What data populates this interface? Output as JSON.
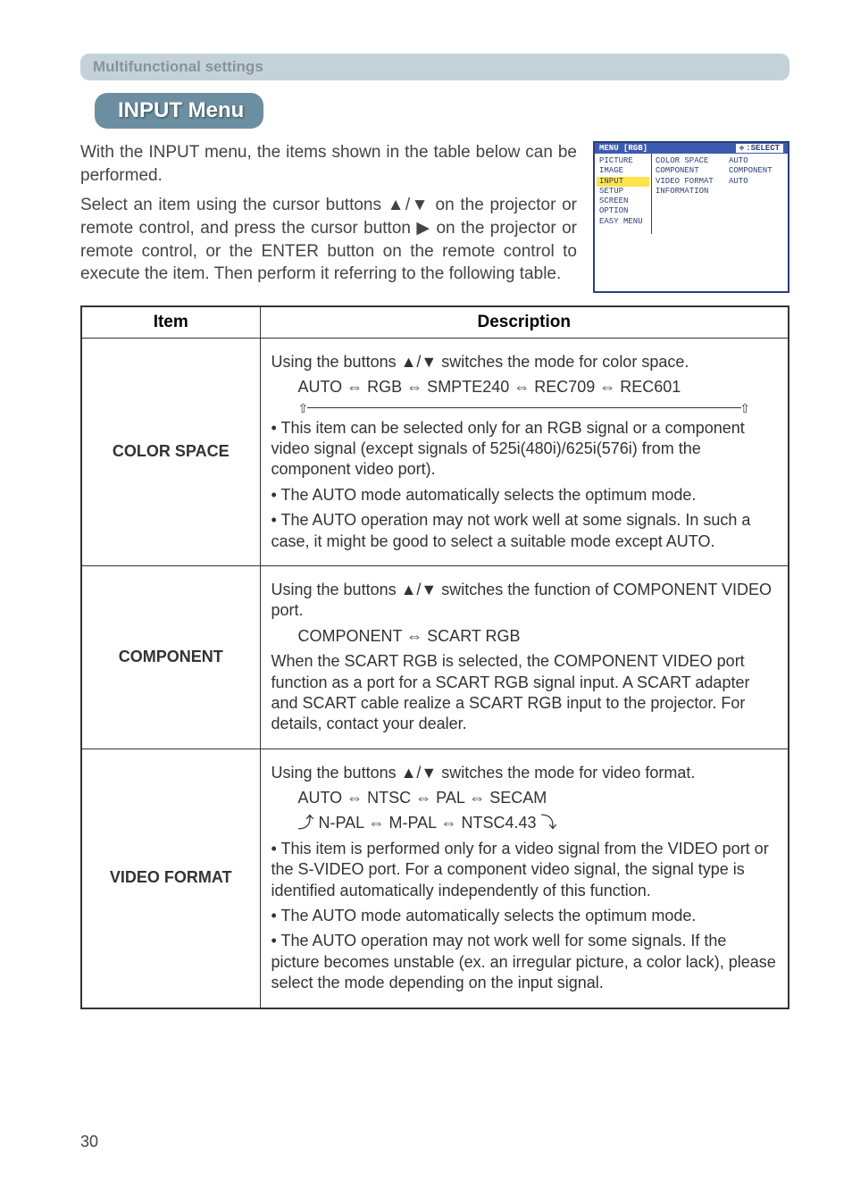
{
  "section_banner": "Multifunctional settings",
  "menu_title": "INPUT Menu",
  "intro": {
    "p1": "With the INPUT menu, the items shown in the table below can be performed.",
    "p2": "Select an item using the cursor buttons ▲/▼ on the projector or remote control, and press the cursor button ▶ on the projector or remote control, or the ENTER button on the remote control to execute the item. Then perform it referring to the following table."
  },
  "osd": {
    "header_left": "MENU [RGB]",
    "header_right": ":SELECT",
    "left_items": [
      "PICTURE",
      "IMAGE",
      "INPUT",
      "SETUP",
      "SCREEN",
      "OPTION",
      "EASY MENU"
    ],
    "highlight_index": 2,
    "right_rows": [
      {
        "k": "COLOR SPACE",
        "v": "AUTO"
      },
      {
        "k": "COMPONENT",
        "v": "COMPONENT"
      },
      {
        "k": "VIDEO FORMAT",
        "v": "AUTO"
      },
      {
        "k": "INFORMATION",
        "v": ""
      }
    ]
  },
  "table": {
    "head_item": "Item",
    "head_desc": "Description",
    "rows": [
      {
        "item": "COLOR SPACE",
        "desc": {
          "l1": "Using the buttons ▲/▼ switches the mode for color space.",
          "cycle": "AUTO ⇔ RGB ⇔ SMPTE240 ⇔ REC709 ⇔ REC601",
          "l2": "• This item can be selected only for an RGB signal or a component video signal (except signals of 525i(480i)/625i(576i) from the component video port).",
          "l3": "• The AUTO mode automatically selects the optimum mode.",
          "l4": "• The AUTO operation may not work well at some signals. In such a case, it might be good to select a suitable mode except AUTO."
        }
      },
      {
        "item": "COMPONENT",
        "desc": {
          "l1": "Using the buttons ▲/▼ switches the function of COMPONENT VIDEO port.",
          "cycle": "COMPONENT ⇔ SCART RGB",
          "l2": "When the SCART RGB is selected, the COMPONENT VIDEO port function as a port for a SCART RGB signal input. A SCART adapter and SCART cable realize a SCART RGB input to the projector. For details, contact your dealer."
        }
      },
      {
        "item": "VIDEO FORMAT",
        "desc": {
          "l1": "Using the buttons ▲/▼ switches the mode for video format.",
          "cycle1": "AUTO  ⇔  NTSC  ⇔  PAL  ⇔  SECAM",
          "cycle2": "⤴ N-PAL ⇔ M-PAL ⇔ NTSC4.43 ⤵",
          "l2": "• This item is performed only for a video signal from the VIDEO port or the S-VIDEO port. For a component video signal, the signal type is identified automatically independently of this function.",
          "l3": "• The AUTO mode automatically selects the optimum mode.",
          "l4": "• The AUTO operation may not work well for some signals. If the picture becomes unstable (ex. an irregular picture, a color lack), please select the mode depending on the input signal."
        }
      }
    ]
  },
  "page_num": "30"
}
